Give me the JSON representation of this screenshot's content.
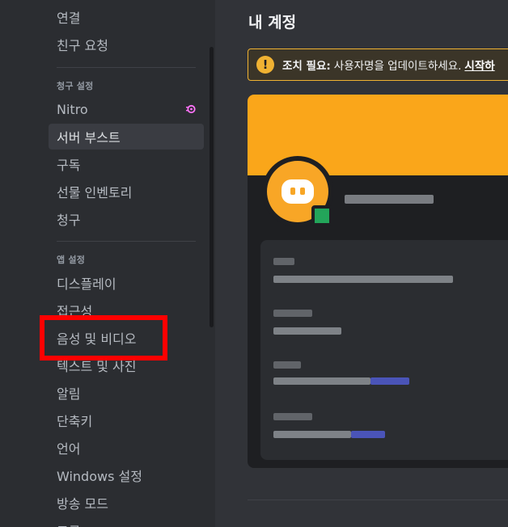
{
  "sidebar": {
    "items_top": [
      {
        "label": "연결"
      },
      {
        "label": "친구 요청"
      }
    ],
    "billing_header": "청구 설정",
    "billing_items": [
      {
        "label": "Nitro"
      },
      {
        "label": "서버 부스트"
      },
      {
        "label": "구독"
      },
      {
        "label": "선물 인벤토리"
      },
      {
        "label": "청구"
      }
    ],
    "app_header": "앱 설정",
    "app_items": [
      {
        "label": "디스플레이"
      },
      {
        "label": "접근성"
      },
      {
        "label": "음성 및 비디오"
      },
      {
        "label": "텍스트 및 사진"
      },
      {
        "label": "알림"
      },
      {
        "label": "단축키"
      },
      {
        "label": "언어"
      },
      {
        "label": "Windows 설정"
      },
      {
        "label": "방송 모드"
      },
      {
        "label": "고급"
      }
    ],
    "selected": "서버 부스트",
    "highlighted": "음성 및 비디오"
  },
  "main": {
    "title": "내 계정",
    "warning": {
      "icon": "!",
      "title": "조치 필요:",
      "message": "사용자명을 업데이트하세요.",
      "link": "시작하"
    }
  },
  "colors": {
    "sidebar_bg": "#2b2d31",
    "main_bg": "#313338",
    "banner_orange": "#faa61a",
    "warning_yellow": "#f0b232",
    "highlight_red": "#ff0000",
    "nitro_pink": "#ff73fa",
    "online_green": "#23a55a"
  }
}
